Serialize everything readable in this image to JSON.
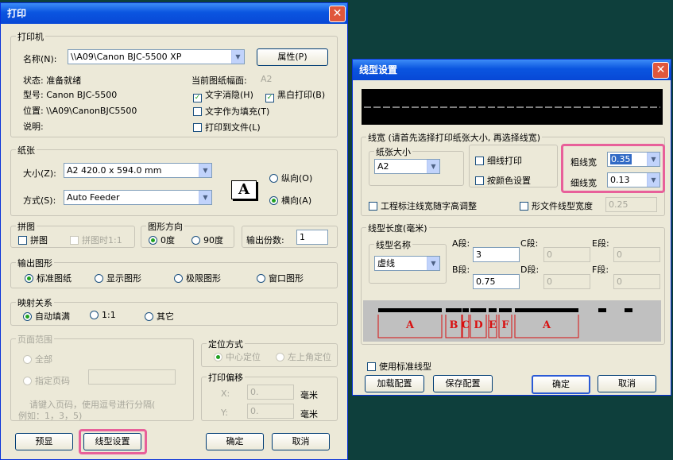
{
  "print": {
    "title": "打印",
    "printer_group": "打印机",
    "name_label": "名称(N):",
    "printer_name": "\\\\A09\\Canon BJC-5500 XP",
    "props_btn": "属性(P)",
    "status": "状态: 准备就绪",
    "model": "型号: Canon BJC-5500",
    "location": "位置: \\\\A09\\CanonBJC5500",
    "comment": "说明:",
    "paper_size_label": "当前图纸幅面:",
    "paper_size_value": "A2",
    "chk_text_hide": "文字消隐(H)",
    "chk_bw": "黑白打印(B)",
    "chk_text_fill": "文字作为填充(T)",
    "chk_to_file": "打印到文件(L)",
    "paper_group": "纸张",
    "size_label": "大小(Z):",
    "size_value": "A2 420.0 x 594.0 mm",
    "mode_label": "方式(S):",
    "mode_value": "Auto Feeder",
    "portrait": "纵向(O)",
    "landscape": "横向(A)",
    "tile_group": "拼图",
    "tile": "拼图",
    "tile_1to1": "拼图时1:1",
    "dir_group": "图形方向",
    "deg0": "0度",
    "deg90": "90度",
    "copies_label": "输出份数:",
    "copies_value": "1",
    "output_group": "输出图形",
    "std": "标准图纸",
    "disp": "显示图形",
    "extent": "极限图形",
    "window": "窗口图形",
    "map_group": "映射关系",
    "auto_fill": "自动填满",
    "one_one": "1:1",
    "other": "其它",
    "page_group": "页面范围",
    "all": "全部",
    "pages": "指定页码",
    "page_hint1": "请键入页码，使用逗号进行分隔(",
    "page_hint2": "例如：1，3，5)",
    "pos_group": "定位方式",
    "center": "中心定位",
    "upper_left": "左上角定位",
    "offset_group": "打印偏移",
    "x_label": "X:",
    "y_label": "Y:",
    "x_val": "0.",
    "y_val": "0.",
    "unit": "毫米",
    "preview": "预显",
    "linetype_btn": "线型设置",
    "ok": "确定",
    "cancel": "取消"
  },
  "line": {
    "title": "线型设置",
    "width_group": "线宽 (请首先选择打印纸张大小, 再选择线宽)",
    "paper_group": "纸张大小",
    "paper_value": "A2",
    "fine_print": "细线打印",
    "by_color": "按颜色设置",
    "thick_label": "粗线宽",
    "thick_value": "0.35",
    "thin_label": "细线宽",
    "thin_value": "0.13",
    "annot_adjust": "工程标注线宽随字高调整",
    "file_width": "形文件线型宽度",
    "file_width_value": "0.25",
    "len_group": "线型长度(毫米)",
    "name_group": "线型名称",
    "name_value": "虚线",
    "A": "A段:",
    "B": "B段:",
    "C": "C段:",
    "D": "D段:",
    "E": "E段:",
    "F": "F段:",
    "A_val": "3",
    "B_val": "0.75",
    "C_val": "0",
    "D_val": "0",
    "E_val": "0",
    "F_val": "0",
    "preview_letters": [
      "A",
      "B",
      "C",
      "D",
      "E",
      "F",
      "A"
    ],
    "use_std": "使用标准线型",
    "load": "加载配置",
    "save": "保存配置",
    "ok": "确定",
    "cancel": "取消"
  }
}
